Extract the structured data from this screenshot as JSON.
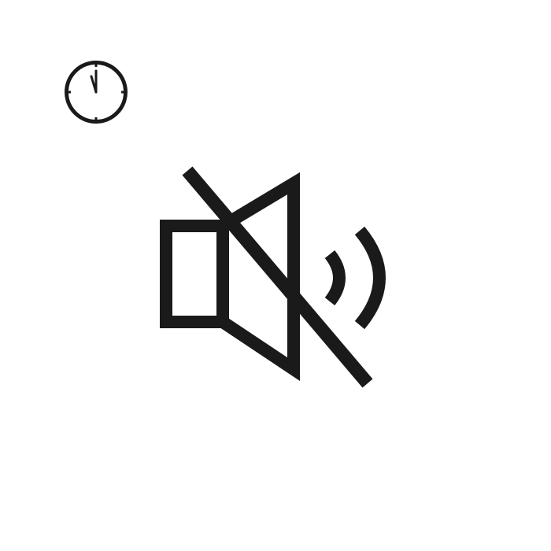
{
  "icons": {
    "clock": "clock-icon",
    "mute": "speaker-muted-icon"
  },
  "colors": {
    "background": "#ffffff",
    "icon": "#1a1a1a"
  }
}
